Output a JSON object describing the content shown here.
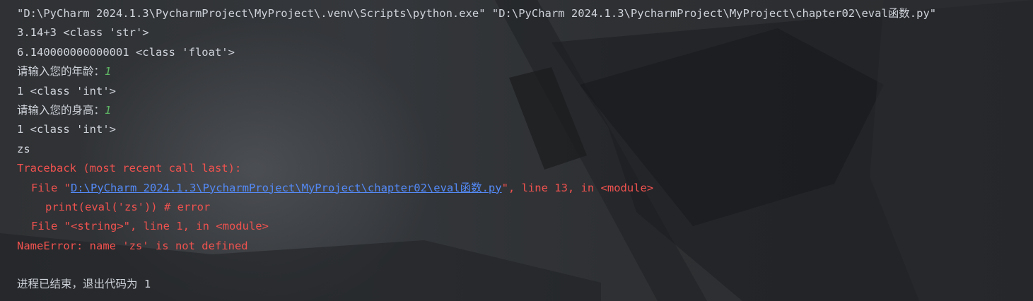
{
  "console": {
    "command": "\"D:\\PyCharm 2024.1.3\\PycharmProject\\MyProject\\.venv\\Scripts\\python.exe\" \"D:\\PyCharm 2024.1.3\\PycharmProject\\MyProject\\chapter02\\eval函数.py\"",
    "out1": "3.14+3 <class 'str'>",
    "out2": "6.140000000000001 <class 'float'>",
    "prompt_age": "请输入您的年龄：",
    "input_age": "1",
    "out3": "1 <class 'int'>",
    "prompt_height": "请输入您的身高：",
    "input_height": "1",
    "out4": "1 <class 'int'>",
    "out5": "zs",
    "traceback": {
      "header": "Traceback (most recent call last):",
      "frame1_prefix": "File \"",
      "frame1_link": "D:\\PyCharm 2024.1.3\\PycharmProject\\MyProject\\chapter02\\eval函数.py",
      "frame1_suffix": "\", line 13, in <module>",
      "frame1_code": "print(eval('zs')) # error",
      "frame2": "File \"<string>\", line 1, in <module>",
      "error": "NameError: name 'zs' is not defined"
    },
    "exit_message": "进程已结束，退出代码为 1"
  }
}
